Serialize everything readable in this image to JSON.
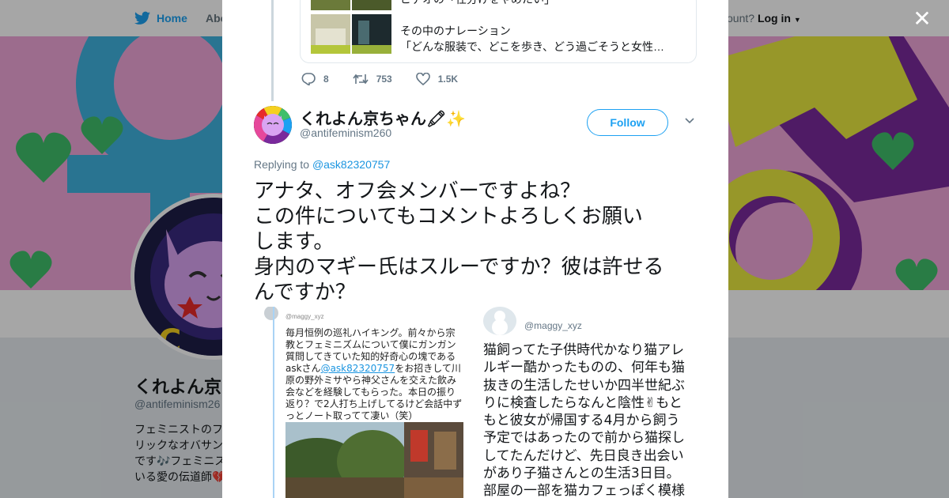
{
  "colors": {
    "twitter_blue": "#1da1f2",
    "link_blue": "#1b95e0",
    "text": "#14171a",
    "muted": "#657786",
    "banner_pink": "#f0a6d9"
  },
  "background": {
    "nav": {
      "home_label": "Home",
      "about_label": "Abo",
      "account_text": "ccount?",
      "login_label": "Log in"
    },
    "profile": {
      "name": "くれよん京",
      "handle": "@antifeminism26",
      "bio_lines": [
        "フェミニストのフ",
        "リックなオバサン",
        "です🎶フェミニス",
        "いる愛の伝道師💔"
      ]
    }
  },
  "modal": {
    "close_icon": "close-icon",
    "quoted": {
      "lines": [
        "ビデオの「仕分けをやめたい」",
        "",
        "その中のナレーション",
        "「どんな服装で、どこを歩き、どう過ごそうと女性…"
      ]
    },
    "actions": {
      "reply_count": "8",
      "retweet_count": "753",
      "like_count": "1.5K"
    },
    "tweet": {
      "author_name": "くれよん京ちゃん🖍✨",
      "author_handle": "@antifeminism260",
      "follow_label": "Follow",
      "replying_prefix": "Replying to ",
      "replying_handle": "@ask82320757",
      "text_lines": [
        "アナタ、オフ会メンバーですよね？",
        "この件についてもコメントよろしくお願い",
        "します。",
        "身内のマギー氏はスルーですか？彼は許せる",
        "んですか？"
      ]
    },
    "media": {
      "left": {
        "handle": "@maggy_xyz",
        "text_before": "毎月恒例の巡礼ハイキング。前々から宗教とフェミニズムについて僕にガンガン質問してきていた知的好奇心の塊であるaskさん",
        "mention": "@ask82320757",
        "text_after": "をお招きして川原の野外ミサやら神父さんを交えた飲み会などを経験してもらった。本日の振り返り？で2人打ち上げしてるけど会話中ずっとノート取ってて凄い（笑）"
      },
      "right": {
        "handle": "@maggy_xyz",
        "lines": [
          "猫飼ってた子供時代かなり猫アレ",
          "ルギー酷かったものの、何年も猫",
          "抜きの生活したせいか四半世紀ぶ",
          "りに検査したらなんと陰性✌もと",
          "もと彼女が帰国する4月から飼う",
          "予定ではあったので前から猫探し",
          "してたんだけど、先日良き出会い",
          "があり子猫さんとの生活3日目。",
          "部屋の一部を猫カフェっぽく模様"
        ]
      }
    }
  }
}
